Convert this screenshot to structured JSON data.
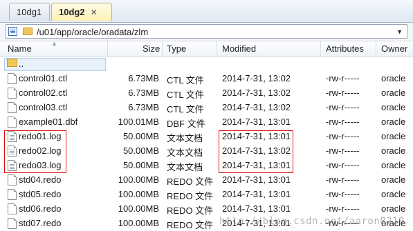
{
  "tabs": [
    {
      "label": "10dg1"
    },
    {
      "label": "10dg2",
      "close": "✕"
    }
  ],
  "address": {
    "path": "/u01/app/oracle/oradata/zlm",
    "dropdown": "▼"
  },
  "columns": {
    "name": "Name",
    "size": "Size",
    "type": "Type",
    "modified": "Modified",
    "attributes": "Attributes",
    "owner": "Owner"
  },
  "up_row": {
    "name": ".."
  },
  "files": [
    {
      "name": "control01.ctl",
      "size": "6.73MB",
      "type": "CTL 文件",
      "modified": "2014-7-31, 13:02",
      "attributes": "-rw-r-----",
      "owner": "oracle"
    },
    {
      "name": "control02.ctl",
      "size": "6.73MB",
      "type": "CTL 文件",
      "modified": "2014-7-31, 13:02",
      "attributes": "-rw-r-----",
      "owner": "oracle"
    },
    {
      "name": "control03.ctl",
      "size": "6.73MB",
      "type": "CTL 文件",
      "modified": "2014-7-31, 13:02",
      "attributes": "-rw-r-----",
      "owner": "oracle"
    },
    {
      "name": "example01.dbf",
      "size": "100.01MB",
      "type": "DBF 文件",
      "modified": "2014-7-31, 13:01",
      "attributes": "-rw-r-----",
      "owner": "oracle"
    },
    {
      "name": "redo01.log",
      "size": "50.00MB",
      "type": "文本文档",
      "modified": "2014-7-31, 13:01",
      "attributes": "-rw-r-----",
      "owner": "oracle"
    },
    {
      "name": "redo02.log",
      "size": "50.00MB",
      "type": "文本文档",
      "modified": "2014-7-31, 13:02",
      "attributes": "-rw-r-----",
      "owner": "oracle"
    },
    {
      "name": "redo03.log",
      "size": "50.00MB",
      "type": "文本文档",
      "modified": "2014-7-31, 13:01",
      "attributes": "-rw-r-----",
      "owner": "oracle"
    },
    {
      "name": "std04.redo",
      "size": "100.00MB",
      "type": "REDO 文件",
      "modified": "2014-7-31, 13:01",
      "attributes": "-rw-r-----",
      "owner": "oracle"
    },
    {
      "name": "std05.redo",
      "size": "100.00MB",
      "type": "REDO 文件",
      "modified": "2014-7-31, 13:01",
      "attributes": "-rw-r-----",
      "owner": "oracle"
    },
    {
      "name": "std06.redo",
      "size": "100.00MB",
      "type": "REDO 文件",
      "modified": "2014-7-31, 13:01",
      "attributes": "-rw-r-----",
      "owner": "oracle"
    },
    {
      "name": "std07.redo",
      "size": "100.00MB",
      "type": "REDO 文件",
      "modified": "2014-7-31, 13:01",
      "attributes": "-rw-r-----",
      "owner": "oracle"
    }
  ],
  "watermark": "http://blog.csdn.net/aaron8219"
}
